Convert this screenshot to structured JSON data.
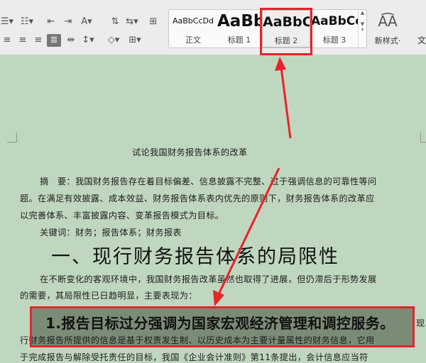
{
  "toolbar": {
    "row1_icons": [
      "bullet-list-icon",
      "numbered-list-icon",
      "decrease-indent-icon",
      "increase-indent-icon",
      "chinese-layout-icon",
      "sort-icon",
      "spacing-icon",
      "table-border-icon"
    ],
    "row2_icons": [
      "align-left-icon",
      "align-center-icon",
      "align-right-icon",
      "justify-icon",
      "distribute-icon",
      "line-spacing-icon",
      "shading-icon",
      "border-icon"
    ],
    "styles": [
      {
        "preview": "AaBbCcDd",
        "label": "正文"
      },
      {
        "preview": "AaBb",
        "label": "标题 1"
      },
      {
        "preview": "AaBbC",
        "label": "标题 2"
      },
      {
        "preview": "AaBbCc",
        "label": "标题 3"
      }
    ],
    "new_style_label": "新样式·",
    "wen_label": "文"
  },
  "document": {
    "title": "试论我国财务报告体系的改革",
    "abstract_lines": [
      "摘　要：我国财务报告存在着目标偏差、信息披露不完整、过于强调信息的可靠性等问",
      "题。在满足有效披露、成本效益、财务报告体系表内优先的原则下，财务报告体系的改革应",
      "以完善体系、丰富披露内容、变革报告模式为目标。"
    ],
    "keywords": "关键词：财务；报告体系；财务报表",
    "heading1": "一、现行财务报告体系的局限性",
    "para_lines": [
      "在不断变化的客观环境中，我国财务报告改革虽然也取得了进展，但仍滞后于形势发展",
      "的需要，其局限性已日趋明显，主要表现为："
    ],
    "heading2": "1.报告目标过分强调为国家宏观经济管理和调控服务。",
    "trail_char": "现",
    "body_lines": [
      "行财务报告所提供的信息是基于权责发生制、以历史成本为主要计量属性的财务信息，它用",
      "于完成报告与解除受托责任的目标，我国《企业会计准则》第11条提出，会计信息应当符"
    ]
  },
  "colors": {
    "annotation": "#e8232a",
    "page_bg": "#c0d7bf",
    "highlight": "#7b8c76"
  }
}
